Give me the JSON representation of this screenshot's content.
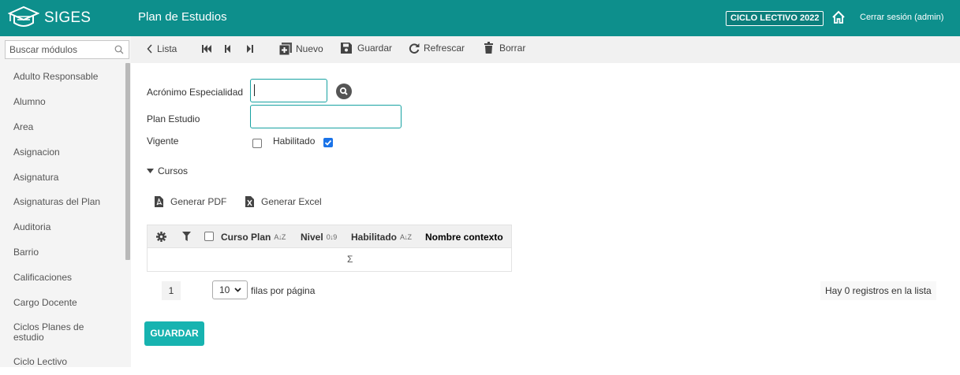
{
  "header": {
    "logo_text": "SIGES",
    "page_title": "Plan de Estudios",
    "ciclo_badge": "CICLO LECTIVO 2022",
    "logout": "Cerrar sesión (admin)"
  },
  "sidebar": {
    "search_placeholder": "Buscar módulos",
    "items": [
      {
        "label": "Adulto Responsable"
      },
      {
        "label": "Alumno"
      },
      {
        "label": "Area"
      },
      {
        "label": "Asignacion"
      },
      {
        "label": "Asignatura"
      },
      {
        "label": "Asignaturas del Plan"
      },
      {
        "label": "Auditoria"
      },
      {
        "label": "Barrio"
      },
      {
        "label": "Calificaciones"
      },
      {
        "label": "Cargo Docente"
      },
      {
        "label": "Ciclos Planes de estudio"
      },
      {
        "label": "Ciclo Lectivo"
      }
    ]
  },
  "toolbar": {
    "list": "Lista",
    "new": "Nuevo",
    "save": "Guardar",
    "refresh": "Refrescar",
    "delete": "Borrar"
  },
  "form": {
    "acronimo_label": "Acrónimo Especialidad",
    "acronimo_value": "",
    "plan_label": "Plan Estudio",
    "plan_value": "",
    "vigente_label": "Vigente",
    "vigente_checked": false,
    "habilitado_label": "Habilitado",
    "habilitado_checked": true
  },
  "cursos": {
    "section_label": "Cursos",
    "pdf_label": "Generar PDF",
    "excel_label": "Generar Excel",
    "columns": [
      {
        "label": "Curso Plan",
        "sort": "A↓Z"
      },
      {
        "label": "Nivel",
        "sort": "0↓9"
      },
      {
        "label": "Habilitado",
        "sort": "A↓Z"
      },
      {
        "label": "Nombre contexto",
        "sort": ""
      }
    ],
    "footer_symbol": "Σ",
    "current_page": "1",
    "rows_per_page": "10",
    "rows_label": "filas por página",
    "record_count": "Hay 0 registros en la lista"
  },
  "actions": {
    "save_button": "GUARDAR"
  },
  "colors": {
    "brand": "#0d8f8c",
    "button": "#17b3b0",
    "checkbox": "#1a73e8"
  }
}
